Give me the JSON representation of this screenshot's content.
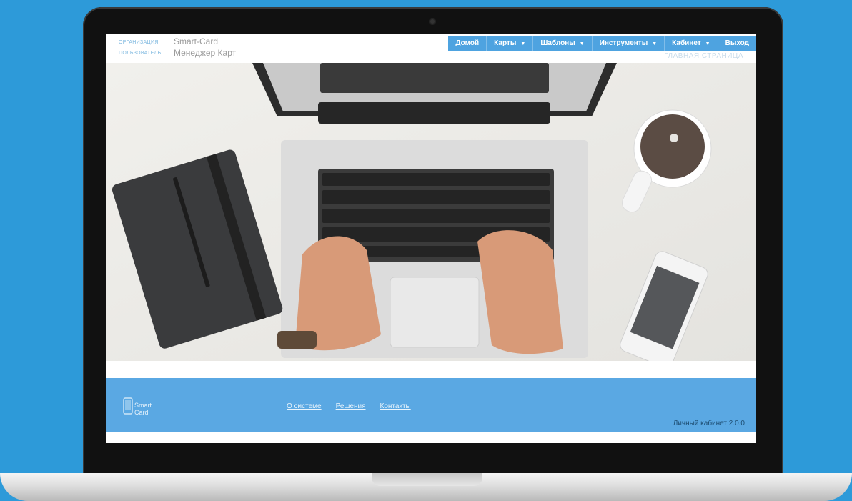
{
  "header": {
    "org_label": "ОРГАНИЗАЦИЯ:",
    "org_value": "Smart-Card",
    "user_label": "ПОЛЬЗОВАТЕЛЬ:",
    "user_value": "Менеджер Карт",
    "breadcrumb": "ГЛАВНАЯ СТРАНИЦА"
  },
  "nav": {
    "home": "Домой",
    "cards": "Карты",
    "templates": "Шаблоны",
    "tools": "Инструменты",
    "cabinet": "Кабинет",
    "logout": "Выход"
  },
  "footer": {
    "logo_line1": "Smart",
    "logo_line2": "Card",
    "links": [
      "О системе",
      "Решения",
      "Контакты"
    ],
    "version": "Личный кабинет 2.0.0"
  },
  "colors": {
    "background": "#2d9ad9",
    "nav": "#4ea3e0",
    "footer": "#5aa8e3"
  },
  "icons": [
    "phone-icon",
    "caret-down-icon"
  ]
}
